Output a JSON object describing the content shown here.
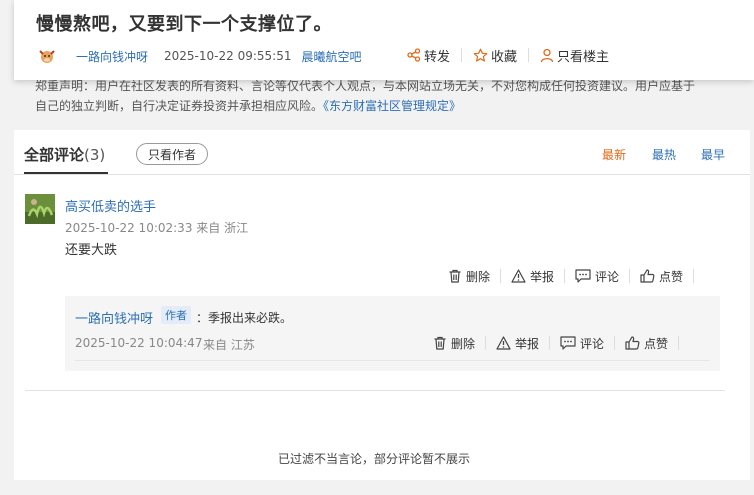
{
  "post": {
    "title": "慢慢熬吧，又要到下一个支撑位了。",
    "author": "一路向钱冲呀",
    "time": "2025-10-22 09:55:51",
    "forum": "晨曦航空吧",
    "actions": {
      "share": "转发",
      "favorite": "收藏",
      "only_op": "只看楼主"
    }
  },
  "disclaimer": {
    "line1": "郑重声明：用户在社区发表的所有资料、言论等仅代表个人观点，与本网站立场无关，不对您构成任何投资建议。用户应基于",
    "line2": "自己的独立判断，自行决定证券投资并承担相应风险。",
    "link": "《东方财富社区管理规定》"
  },
  "comments_section": {
    "tab_label": "全部评论",
    "count": "(3)",
    "only_author": "只看作者",
    "sort": {
      "newest": "最新",
      "hottest": "最热",
      "earliest": "最早"
    },
    "active_sort": "newest"
  },
  "comment": {
    "user": "高买低卖的选手",
    "time_loc": "2025-10-22 10:02:33 来自 浙江",
    "text": "还要大跌",
    "actions": {
      "delete": "删除",
      "report": "举报",
      "comment": "评论",
      "like": "点赞"
    }
  },
  "reply": {
    "user": "一路向钱冲呀",
    "badge": "作者",
    "text": "：季报出来必跌。",
    "time": "2025-10-22 10:04:47",
    "location": "来自 江苏",
    "actions": {
      "delete": "删除",
      "report": "举报",
      "comment": "评论",
      "like": "点赞"
    }
  },
  "footer_note": "已过滤不当言论，部分评论暂不展示",
  "colors": {
    "link": "#2c6fb5",
    "active_sort": "#e06a1b",
    "badge_bg": "#e3ecf7"
  }
}
